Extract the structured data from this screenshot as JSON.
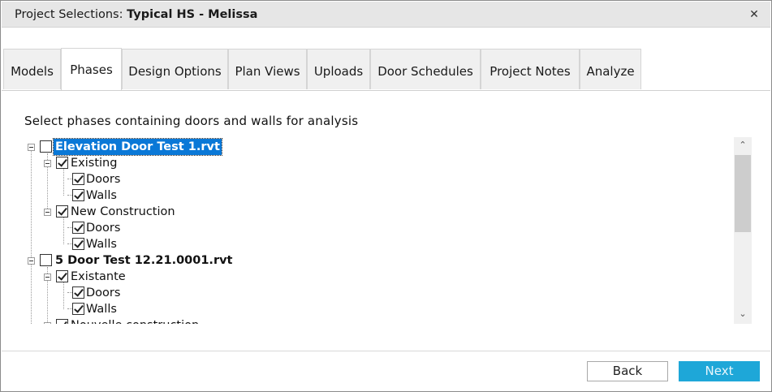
{
  "window": {
    "title_prefix": "Project Selections: ",
    "project_name": "Typical HS - Melissa",
    "close_glyph": "✕"
  },
  "tabs": [
    {
      "label": "Models"
    },
    {
      "label": "Phases",
      "active": true
    },
    {
      "label": "Design Options"
    },
    {
      "label": "Plan Views"
    },
    {
      "label": "Uploads"
    },
    {
      "label": "Door Schedules"
    },
    {
      "label": "Project Notes"
    },
    {
      "label": "Analyze"
    }
  ],
  "instructions": "Select phases containing doors and walls for analysis",
  "tree": [
    {
      "label": "Elevation Door Test 1.rvt",
      "checked": false,
      "selected": true
    },
    {
      "label": "Existing",
      "checked": true
    },
    {
      "label": "Doors",
      "checked": true
    },
    {
      "label": "Walls",
      "checked": true
    },
    {
      "label": "New Construction",
      "checked": true
    },
    {
      "label": "Doors",
      "checked": true
    },
    {
      "label": "Walls",
      "checked": true
    },
    {
      "label": "5 Door Test 12.21.0001.rvt",
      "checked": false
    },
    {
      "label": "Existante",
      "checked": true
    },
    {
      "label": "Doors",
      "checked": true
    },
    {
      "label": "Walls",
      "checked": true
    },
    {
      "label": "Nouvelle construction",
      "checked": true
    }
  ],
  "scrollbar": {
    "up_glyph": "⌃",
    "down_glyph": "⌄"
  },
  "footer": {
    "back_label": "Back",
    "next_label": "Next",
    "next_color": "#1ea7d8"
  },
  "colors": {
    "selection": "#0a78d7",
    "accent": "#1ea7d8"
  }
}
